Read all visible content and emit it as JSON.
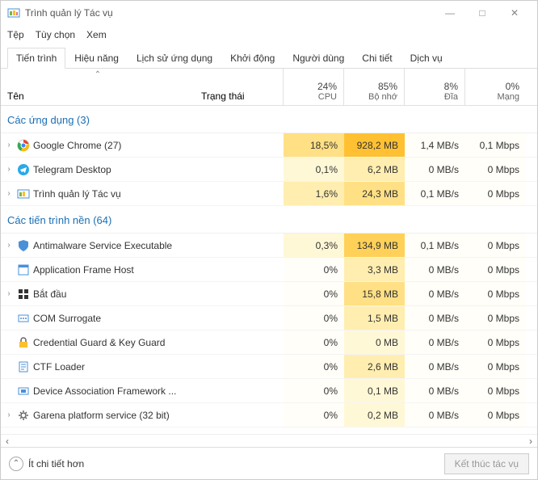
{
  "window": {
    "title": "Trình quản lý Tác vụ",
    "controls": {
      "minimize": "—",
      "maximize": "□",
      "close": "✕"
    }
  },
  "menu": {
    "file": "Tệp",
    "options": "Tùy chọn",
    "view": "Xem"
  },
  "tabs": {
    "processes": "Tiến trình",
    "performance": "Hiệu năng",
    "app_history": "Lịch sử ứng dụng",
    "startup": "Khởi động",
    "users": "Người dùng",
    "details": "Chi tiết",
    "services": "Dịch vụ"
  },
  "columns": {
    "name": "Tên",
    "status": "Trạng thái",
    "cpu_pct": "24%",
    "cpu_label": "CPU",
    "mem_pct": "85%",
    "mem_label": "Bộ nhớ",
    "disk_pct": "8%",
    "disk_label": "Đĩa",
    "net_pct": "0%",
    "net_label": "Mạng"
  },
  "groups": {
    "apps": {
      "label": "Các ứng dụng (3)"
    },
    "background": {
      "label": "Các tiến trình nền (64)"
    }
  },
  "processes": {
    "apps": [
      {
        "name": "Google Chrome (27)",
        "icon": "chrome",
        "expandable": true,
        "cpu": "18,5%",
        "mem": "928,2 MB",
        "disk": "1,4 MB/s",
        "net": "0,1 Mbps",
        "cpu_heat": 3,
        "mem_heat": 4
      },
      {
        "name": "Telegram Desktop",
        "icon": "telegram",
        "expandable": true,
        "cpu": "0,1%",
        "mem": "6,2 MB",
        "disk": "0 MB/s",
        "net": "0 Mbps",
        "cpu_heat": 1,
        "mem_heat": 1
      },
      {
        "name": "Trình quản lý Tác vụ",
        "icon": "taskmgr",
        "expandable": true,
        "cpu": "1,6%",
        "mem": "24,3 MB",
        "disk": "0,1 MB/s",
        "net": "0 Mbps",
        "cpu_heat": 2,
        "mem_heat": 2
      }
    ],
    "background": [
      {
        "name": "Antimalware Service Executable",
        "icon": "shield",
        "expandable": true,
        "cpu": "0,3%",
        "mem": "134,9 MB",
        "disk": "0,1 MB/s",
        "net": "0 Mbps",
        "cpu_heat": 1,
        "mem_heat": 3
      },
      {
        "name": "Application Frame Host",
        "icon": "appframe",
        "expandable": false,
        "cpu": "0%",
        "mem": "3,3 MB",
        "disk": "0 MB/s",
        "net": "0 Mbps",
        "cpu_heat": 0,
        "mem_heat": 1
      },
      {
        "name": "Bắt đầu",
        "icon": "start",
        "expandable": true,
        "cpu": "0%",
        "mem": "15,8 MB",
        "disk": "0 MB/s",
        "net": "0 Mbps",
        "cpu_heat": 0,
        "mem_heat": 2
      },
      {
        "name": "COM Surrogate",
        "icon": "com",
        "expandable": false,
        "cpu": "0%",
        "mem": "1,5 MB",
        "disk": "0 MB/s",
        "net": "0 Mbps",
        "cpu_heat": 0,
        "mem_heat": 1
      },
      {
        "name": "Credential Guard & Key Guard",
        "icon": "cred",
        "expandable": false,
        "cpu": "0%",
        "mem": "0 MB",
        "disk": "0 MB/s",
        "net": "0 Mbps",
        "cpu_heat": 0,
        "mem_heat": 0
      },
      {
        "name": "CTF Loader",
        "icon": "ctf",
        "expandable": false,
        "cpu": "0%",
        "mem": "2,6 MB",
        "disk": "0 MB/s",
        "net": "0 Mbps",
        "cpu_heat": 0,
        "mem_heat": 1
      },
      {
        "name": "Device Association Framework ...",
        "icon": "device",
        "expandable": false,
        "cpu": "0%",
        "mem": "0,1 MB",
        "disk": "0 MB/s",
        "net": "0 Mbps",
        "cpu_heat": 0,
        "mem_heat": 0
      },
      {
        "name": "Garena platform service (32 bit)",
        "icon": "gear",
        "expandable": true,
        "cpu": "0%",
        "mem": "0,2 MB",
        "disk": "0 MB/s",
        "net": "0 Mbps",
        "cpu_heat": 0,
        "mem_heat": 0
      }
    ]
  },
  "footer": {
    "fewer_details": "Ít chi tiết hơn",
    "end_task": "Kết thúc tác vụ"
  }
}
